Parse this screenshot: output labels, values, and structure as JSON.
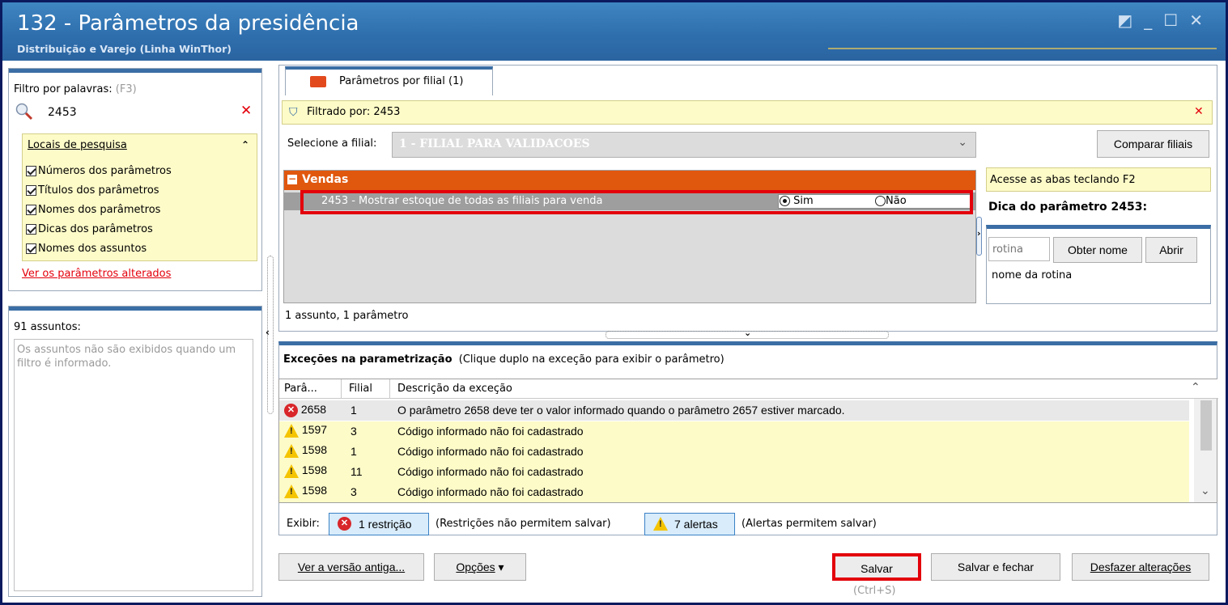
{
  "window": {
    "title": "132 - Parâmetros da presidência",
    "subtitle": "Distribuição e Varejo (Linha WinThor)"
  },
  "filter_panel": {
    "label": "Filtro por palavras:",
    "shortcut": "(F3)",
    "search_value": "2453",
    "locais_title": "Locais de pesquisa",
    "options": [
      "Números dos parâmetros",
      "Títulos dos parâmetros",
      "Nomes dos parâmetros",
      "Dicas dos parâmetros",
      "Nomes dos assuntos"
    ],
    "changed_link": "Ver os parâmetros alterados"
  },
  "subjects_panel": {
    "count_label": "91 assuntos:",
    "message": "Os assuntos não são exibidos quando um filtro é informado."
  },
  "main": {
    "tab_label": "Parâmetros por filial  (1)",
    "filtered_by": "Filtrado por: 2453",
    "branch_label": "Selecione a filial:",
    "branch_value": "1 - FILIAL PARA VALIDACOES",
    "compare_button": "Comparar filiais",
    "group_title": "Vendas",
    "param_label": "2453 - Mostrar estoque de todas as filiais para venda",
    "option_yes": "Sim",
    "option_no": "Não",
    "summary": "1 assunto, 1 parâmetro"
  },
  "tip_panel": {
    "hint": "Acesse as abas teclando F2",
    "title": "Dica do parâmetro 2453:",
    "rotina_placeholder": "rotina",
    "get_name_button": "Obter nome",
    "open_button": "Abrir",
    "rotina_name": "nome da rotina"
  },
  "exceptions": {
    "title": "Exceções na parametrização",
    "subtitle": "(Clique duplo na exceção para exibir o parâmetro)",
    "columns": [
      "Parâ...",
      "Filial",
      "Descrição da exceção"
    ],
    "rows": [
      {
        "type": "error",
        "param": "2658",
        "filial": "1",
        "desc": "O parâmetro 2658 deve ter o valor informado quando o parâmetro 2657 estiver marcado."
      },
      {
        "type": "warning",
        "param": "1597",
        "filial": "3",
        "desc": "Código informado não foi cadastrado"
      },
      {
        "type": "warning",
        "param": "1598",
        "filial": "1",
        "desc": "Código informado não foi cadastrado"
      },
      {
        "type": "warning",
        "param": "1598",
        "filial": "11",
        "desc": "Código informado não foi cadastrado"
      },
      {
        "type": "warning",
        "param": "1598",
        "filial": "3",
        "desc": "Código informado não foi cadastrado"
      }
    ],
    "show_label": "Exibir:",
    "restriction_button": "1 restrição",
    "restriction_note": "(Restrições não permitem salvar)",
    "alert_button": "7 alertas",
    "alert_note": "(Alertas permitem salvar)"
  },
  "footer": {
    "old_version_button": "Ver a versão antiga...",
    "options_button": "Opções",
    "save_button": "Salvar",
    "save_shortcut": "(Ctrl+S)",
    "save_close_button": "Salvar e fechar",
    "undo_button": "Desfazer alterações"
  },
  "colors": {
    "title_bar": "#2f6fae",
    "group_header": "#e0570e",
    "highlight_border": "#e3000b",
    "yellow_panel": "#fdfbc8"
  }
}
